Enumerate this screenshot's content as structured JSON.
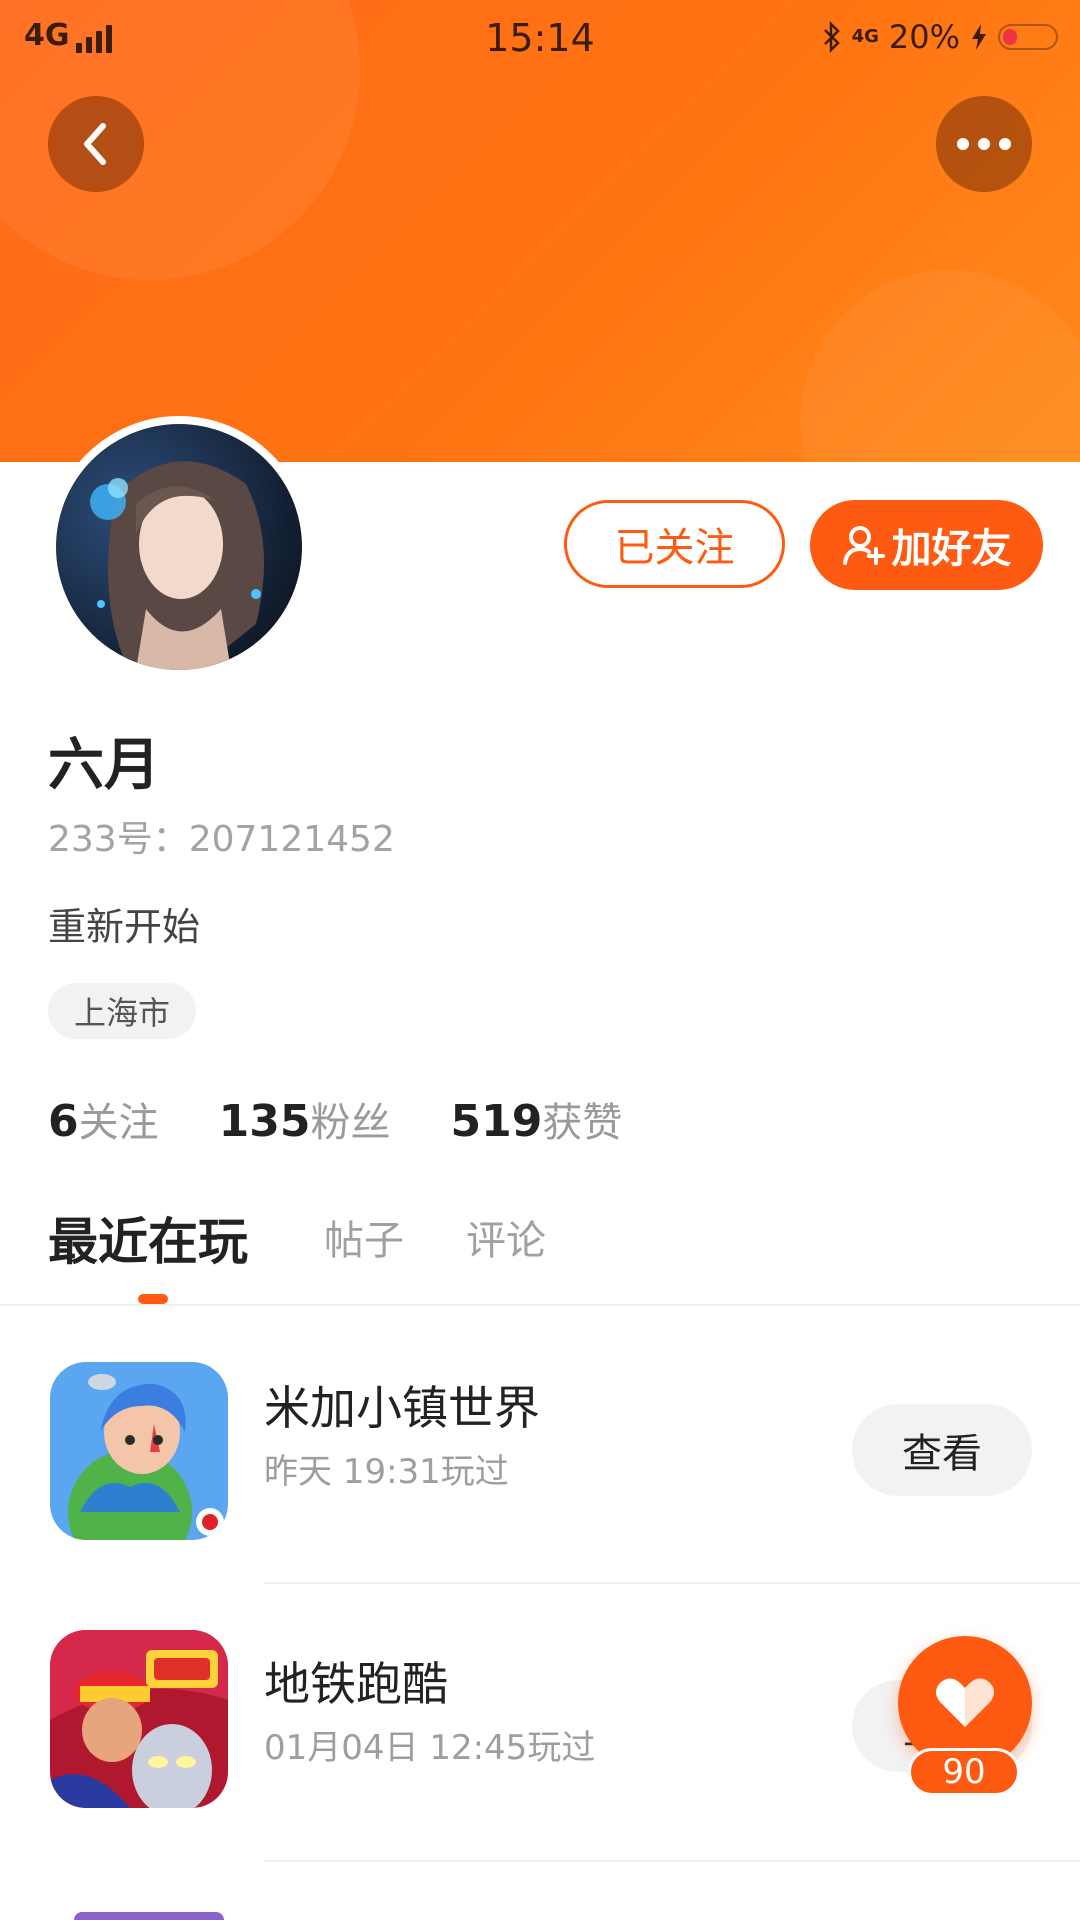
{
  "status_bar": {
    "network": "4G",
    "time": "15:14",
    "network_right": "4G",
    "battery": "20%",
    "icons": [
      "signal-icon",
      "bluetooth-icon",
      "charging-icon",
      "battery-icon"
    ]
  },
  "header": {
    "back_icon": "chevron-left-icon",
    "more_icon": "more-dots-icon",
    "banner_color": "#ff7412"
  },
  "profile": {
    "name": "六月",
    "id_text": "233号：207121452",
    "bio": "重新开始",
    "location": "上海市",
    "follow_button": "已关注",
    "add_friend_button": "加好友",
    "accent_color": "#ff5a12"
  },
  "stats": [
    {
      "num": "6",
      "label": "关注"
    },
    {
      "num": "135",
      "label": "粉丝"
    },
    {
      "num": "519",
      "label": "获赞"
    }
  ],
  "tabs": [
    {
      "label": "最近在玩",
      "active": true
    },
    {
      "label": "帖子",
      "active": false
    },
    {
      "label": "评论",
      "active": false
    }
  ],
  "games": [
    {
      "title": "米加小镇世界",
      "played": "昨天 19:31玩过",
      "action": "查看"
    },
    {
      "title": "地铁跑酷",
      "played": "01月04日 12:45玩过",
      "action": "查看"
    }
  ],
  "like": {
    "count": "90",
    "icon": "heart-icon"
  }
}
